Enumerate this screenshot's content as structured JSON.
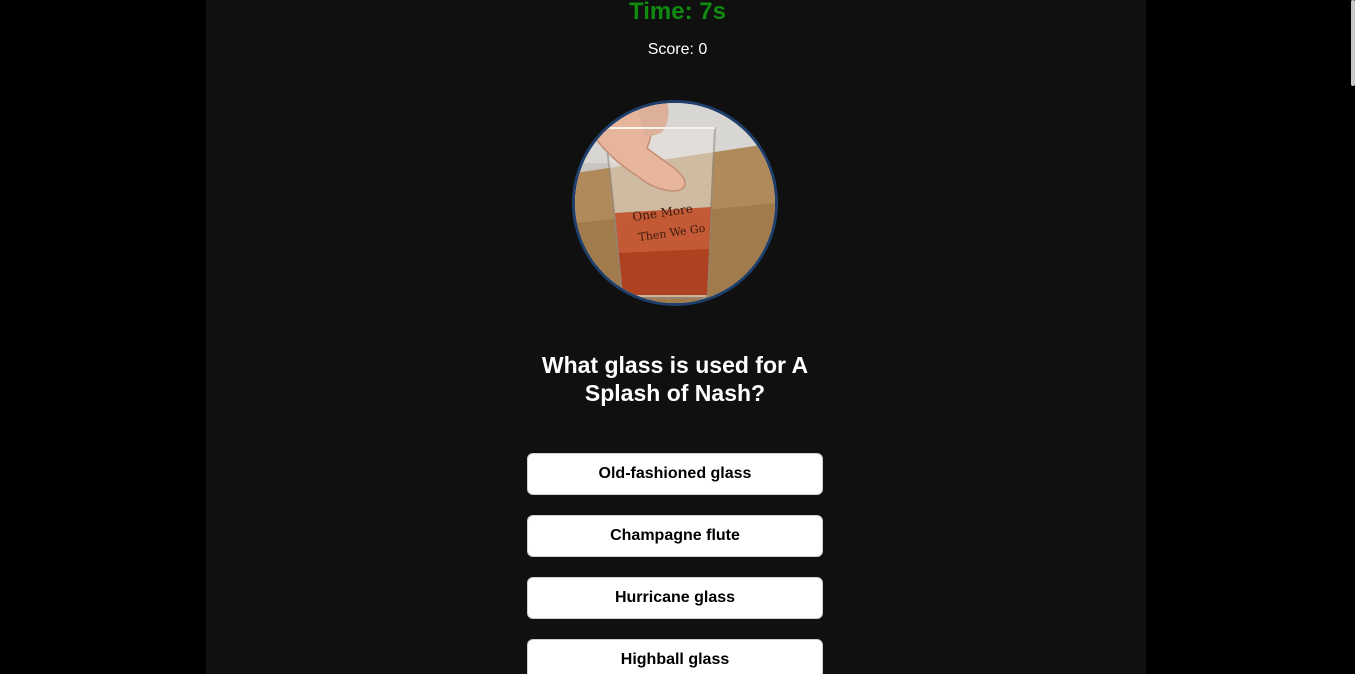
{
  "quiz": {
    "timer_text": "Time: 7s",
    "score_text": "Score: 0",
    "image": {
      "subject": "cocktail in pint glass",
      "border_color": "#1e3f6b"
    },
    "question": "What glass is used for A Splash of Nash?",
    "answers": [
      {
        "label": "Old-fashioned glass"
      },
      {
        "label": "Champagne flute"
      },
      {
        "label": "Hurricane glass"
      },
      {
        "label": "Highball glass"
      }
    ]
  },
  "colors": {
    "page_bg": "#000000",
    "panel_bg": "#101010",
    "timer": "#0f8a0f",
    "text": "#ffffff",
    "button_bg": "#ffffff",
    "button_text": "#000000"
  }
}
